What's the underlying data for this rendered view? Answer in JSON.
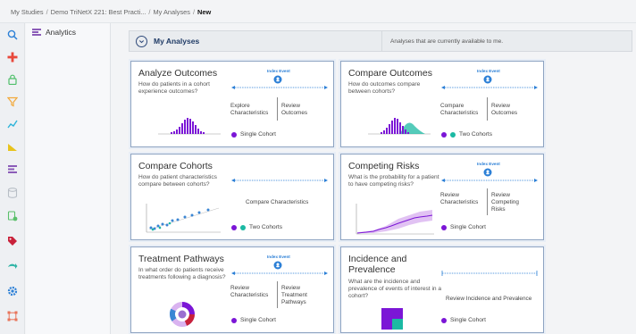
{
  "breadcrumb": {
    "items": [
      "My Studies",
      "Demo TriNetX 221: Best Practi...",
      "My Analyses"
    ],
    "current": "New"
  },
  "sidebar": {
    "item_label": "Analytics"
  },
  "header": {
    "title": "My Analyses",
    "description": "Analyses that are currently available to me."
  },
  "colors": {
    "purple": "#7b16d6",
    "teal": "#1bb9a3",
    "blue": "#2b7fd6",
    "accent": "#1f3b66"
  },
  "cards": [
    {
      "title": "Analyze Outcomes",
      "subtitle": [
        "How do patients in a cohort",
        "experience outcomes?"
      ],
      "index_event": "Index Event",
      "steps": [
        [
          "Explore",
          "Characteristics"
        ],
        [
          "Review",
          "Outcomes"
        ]
      ],
      "cohort": "Single Cohort"
    },
    {
      "title": "Compare Outcomes",
      "subtitle": [
        "How do outcomes compare",
        "between cohorts?"
      ],
      "index_event": "Index Event",
      "steps": [
        [
          "Compare",
          "Characteristics"
        ],
        [
          "Review",
          "Outcomes"
        ]
      ],
      "cohort": "Two Cohorts"
    },
    {
      "title": "Compare Cohorts",
      "subtitle": [
        "How do patient characteristics",
        "compare between cohorts?"
      ],
      "steps": [
        [
          "Compare Characteristics"
        ]
      ],
      "cohort": "Two Cohorts"
    },
    {
      "title": "Competing Risks",
      "subtitle": [
        "What is the probability for a patient",
        "to have competing risks?"
      ],
      "index_event": "Index Event",
      "steps": [
        [
          "Review",
          "Characteristics"
        ],
        [
          "Review",
          "Competing",
          "Risks"
        ]
      ],
      "cohort": "Single Cohort"
    },
    {
      "title": "Treatment Pathways",
      "subtitle": [
        "In what order do patients receive",
        "treatments following a diagnosis?"
      ],
      "index_event": "Index Event",
      "steps": [
        [
          "Review",
          "Characteristics"
        ],
        [
          "Review",
          "Treatment",
          "Pathways"
        ]
      ],
      "cohort": "Single Cohort"
    },
    {
      "title_lines": [
        "Incidence and",
        "Prevalence"
      ],
      "subtitle": [
        "What are the incidence and",
        "prevalence of events of interest in a",
        "cohort?"
      ],
      "steps": [
        [
          "Review Incidence and Prevalence"
        ]
      ],
      "cohort": "Single Cohort"
    }
  ]
}
